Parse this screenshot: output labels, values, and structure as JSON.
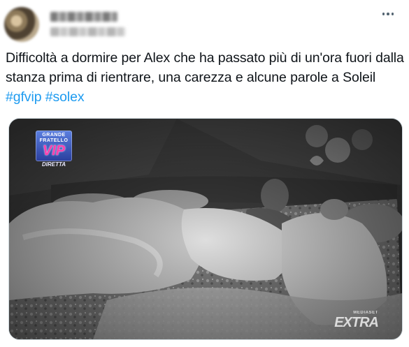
{
  "tweet": {
    "text_main": "Difficoltà a dormire per Alex che ha passato più di un'ora fuori dalla stanza prima di rientrare, una carezza e alcune parole a Soleil ",
    "hashtags": [
      "#gfvip",
      "#solex"
    ]
  },
  "media": {
    "logo_top": "GRANDE FRATELLO",
    "logo_main": "VIP",
    "logo_live": "DIRETTA",
    "watermark_small": "MEDIASET",
    "watermark_big": "EXTRA"
  },
  "icons": {
    "more": "more-horizontal-icon"
  },
  "colors": {
    "hashtag": "#1d9bf0",
    "text": "#0f1419",
    "icon": "#536471"
  }
}
